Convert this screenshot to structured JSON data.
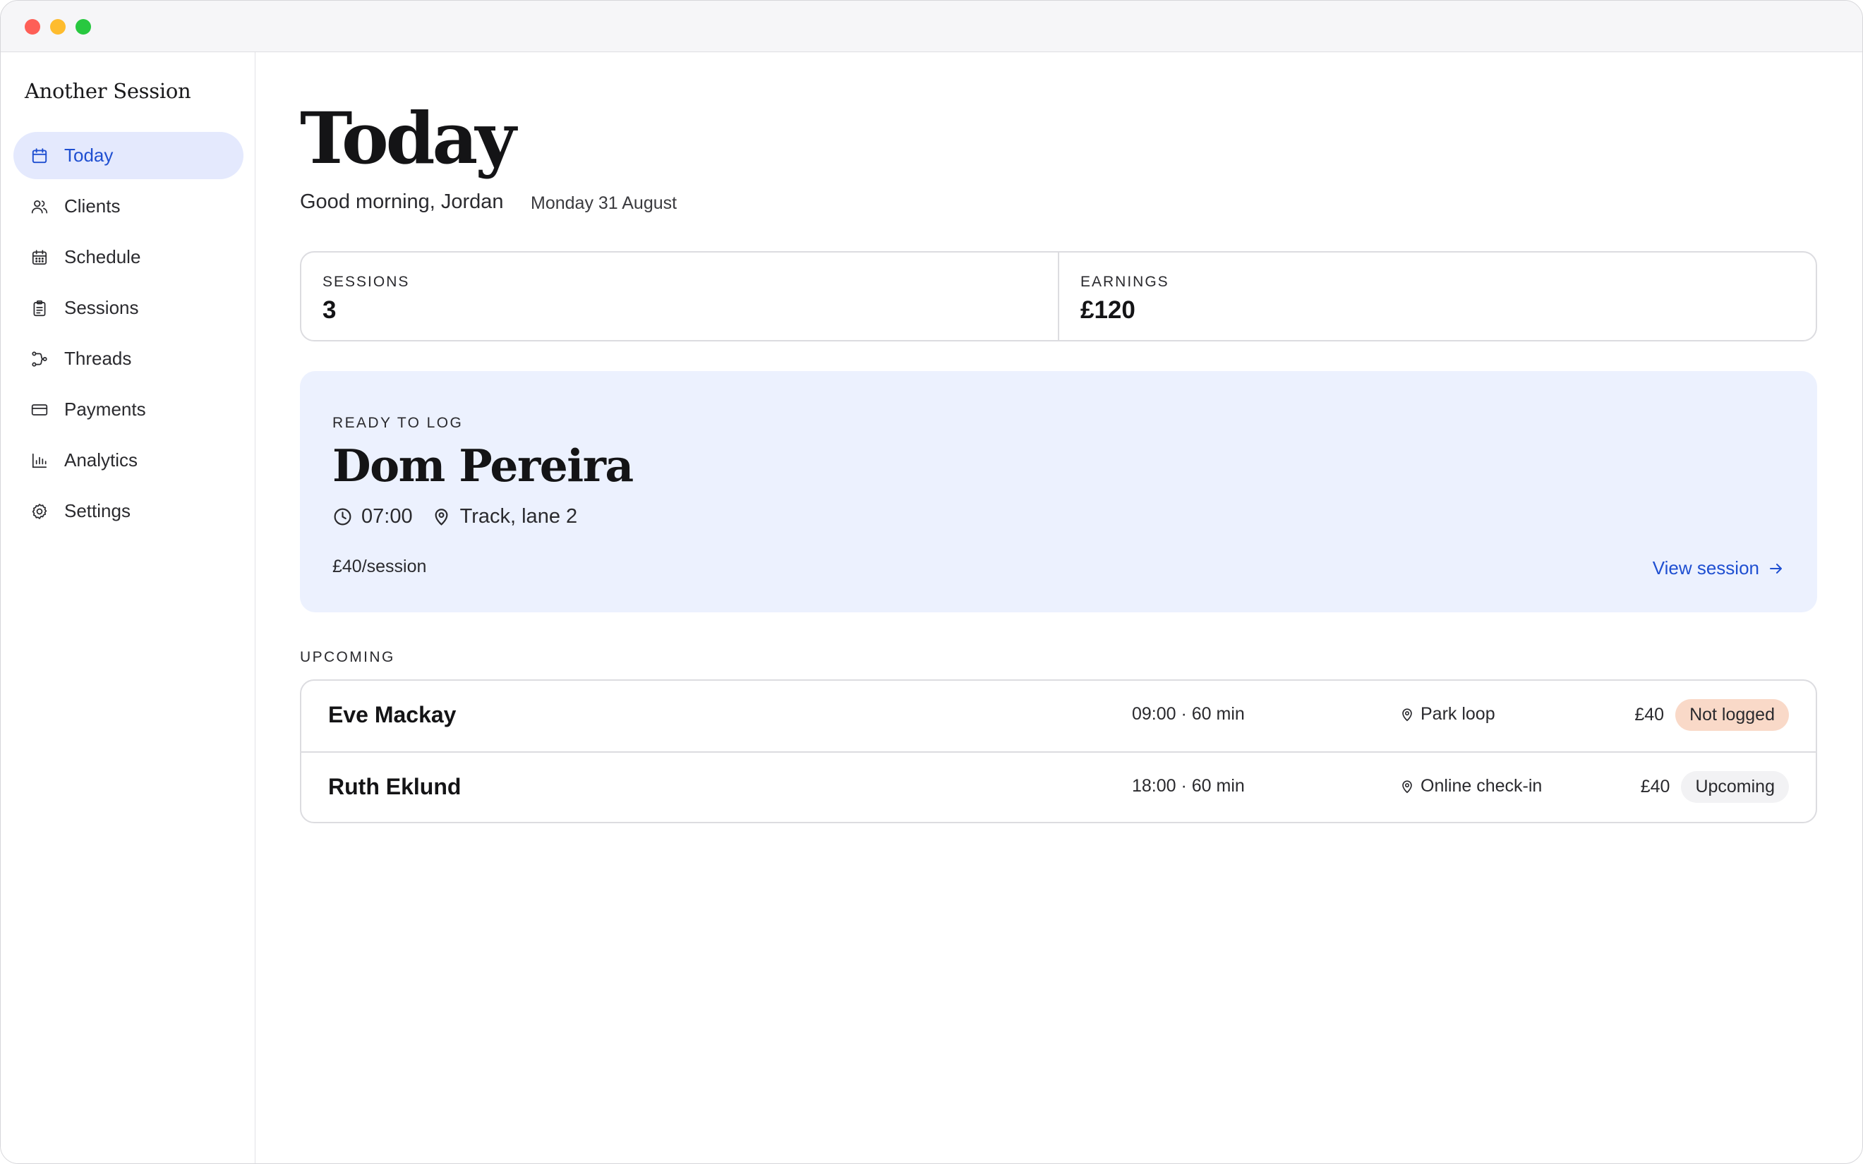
{
  "app": {
    "brand": "Another Session"
  },
  "sidebar": {
    "items": [
      {
        "label": "Today",
        "icon": "calendar-icon",
        "active": true
      },
      {
        "label": "Clients",
        "icon": "users-icon"
      },
      {
        "label": "Schedule",
        "icon": "calendar-grid-icon"
      },
      {
        "label": "Sessions",
        "icon": "clipboard-icon"
      },
      {
        "label": "Threads",
        "icon": "threads-icon"
      },
      {
        "label": "Payments",
        "icon": "credit-card-icon"
      },
      {
        "label": "Analytics",
        "icon": "bar-chart-icon"
      },
      {
        "label": "Settings",
        "icon": "gear-icon"
      }
    ]
  },
  "header": {
    "title": "Today",
    "greeting": "Good morning, Jordan",
    "date": "Monday 31 August"
  },
  "stats": {
    "sessions_label": "SESSIONS",
    "sessions_value": "3",
    "earnings_label": "EARNINGS",
    "earnings_value": "£120"
  },
  "ready": {
    "label": "READY TO LOG",
    "client": "Dom Pereira",
    "time": "07:00",
    "location": "Track, lane 2",
    "rate": "£40/session",
    "link": "View session"
  },
  "upcoming": {
    "label": "UPCOMING",
    "rows": [
      {
        "name": "Eve Mackay",
        "time": "09:00 · 60 min",
        "location": "Park loop",
        "price": "£40",
        "status": "Not logged"
      },
      {
        "name": "Ruth Eklund",
        "time": "18:00 · 60 min",
        "location": "Online check-in",
        "price": "£40",
        "status": "Upcoming"
      }
    ]
  },
  "colors": {
    "accent": "#1f4fd1",
    "active_bg": "#e4e9fd",
    "ready_bg": "#ecf1fe",
    "badge_not_logged": "#f9d9c8",
    "badge_upcoming": "#f2f2f4"
  }
}
